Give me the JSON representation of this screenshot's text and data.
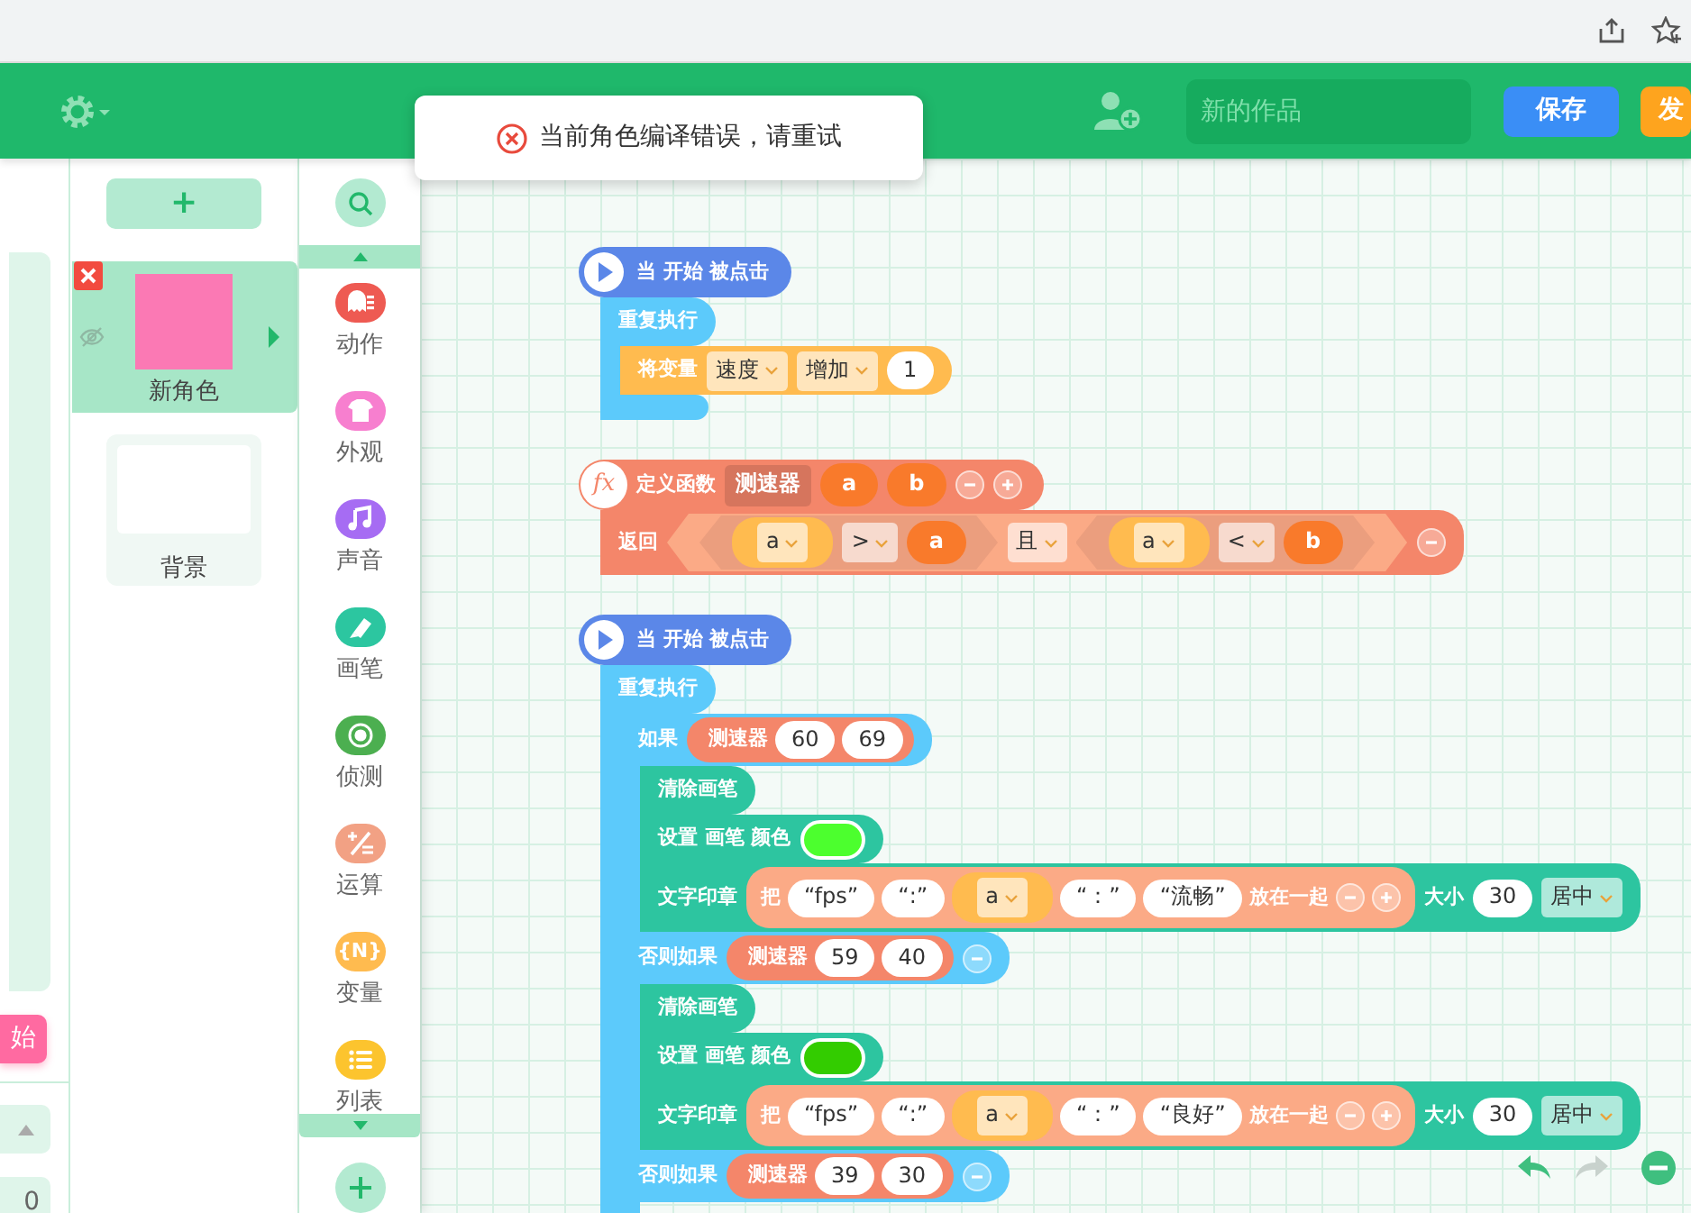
{
  "header": {
    "project_name": {
      "placeholder": "新的作品"
    },
    "buttons": [
      {
        "label": "保存",
        "kind": "save"
      },
      {
        "label": "发",
        "kind": "publish"
      }
    ]
  },
  "toast": {
    "text": "当前角色编译错误，请重试",
    "kind": "error"
  },
  "stage": {
    "start_button": "始",
    "counter": "0"
  },
  "sprites": {
    "add_label": "+",
    "items": [
      {
        "name": "新角色",
        "selected": true,
        "color": "#fb79b4"
      },
      {
        "name": "背景",
        "selected": false,
        "color": "#ffffff"
      }
    ]
  },
  "categories": [
    {
      "label": "动作",
      "color": "#ee5a52",
      "kind": "motion"
    },
    {
      "label": "外观",
      "color": "#f77fcf",
      "kind": "looks"
    },
    {
      "label": "声音",
      "color": "#a66cf3",
      "kind": "sound"
    },
    {
      "label": "画笔",
      "color": "#2cc6a0",
      "kind": "pen"
    },
    {
      "label": "侦测",
      "color": "#4caf50",
      "kind": "sensing"
    },
    {
      "label": "运算",
      "color": "#f2a184",
      "kind": "operators"
    },
    {
      "label": "变量",
      "color": "#ffbb4f",
      "kind": "variables",
      "glyph": "{N}"
    },
    {
      "label": "列表",
      "color": "#fcc42e",
      "kind": "lists"
    }
  ],
  "scripts": [
    {
      "blocks": [
        {
          "kind": "hat",
          "color": "#5b87e8",
          "parts": [
            {
              "kind": "text",
              "text": "当 开始 被点击"
            }
          ]
        },
        {
          "kind": "c",
          "color": "#5ccafb",
          "foot": true,
          "arms": [
            {
              "parts": [
                {
                  "kind": "text",
                  "text": "重复执行"
                }
              ],
              "children": [
                {
                  "kind": "stack",
                  "color": "#ffbb4f",
                  "parts": [
                    {
                      "kind": "text",
                      "text": "将变量"
                    },
                    {
                      "kind": "dropdown",
                      "text": "速度"
                    },
                    {
                      "kind": "dropdown",
                      "text": "增加"
                    },
                    {
                      "kind": "number",
                      "text": "1"
                    }
                  ]
                }
              ]
            }
          ]
        }
      ]
    },
    {
      "blocks": [
        {
          "kind": "define",
          "color": "#f4866a",
          "icon_text": "fx",
          "parts": [
            {
              "kind": "text",
              "text": "定义函数"
            },
            {
              "kind": "name",
              "text": "测速器"
            },
            {
              "kind": "arg",
              "text": "a"
            },
            {
              "kind": "arg",
              "text": "b"
            },
            {
              "kind": "minus"
            },
            {
              "kind": "plus"
            }
          ]
        },
        {
          "kind": "stack",
          "color": "#f4866a",
          "parts": [
            {
              "kind": "text",
              "text": "返回"
            },
            {
              "kind": "bool",
              "parts": [
                {
                  "kind": "bool",
                  "parts": [
                    {
                      "kind": "var",
                      "text": "a"
                    },
                    {
                      "kind": "dropdown",
                      "text": ">"
                    },
                    {
                      "kind": "arg",
                      "text": "a"
                    }
                  ]
                },
                {
                  "kind": "dropdown",
                  "text": "且"
                },
                {
                  "kind": "bool",
                  "parts": [
                    {
                      "kind": "var",
                      "text": "a"
                    },
                    {
                      "kind": "dropdown",
                      "text": "<"
                    },
                    {
                      "kind": "arg",
                      "text": "b"
                    }
                  ]
                }
              ]
            },
            {
              "kind": "minus"
            }
          ]
        }
      ]
    },
    {
      "blocks": [
        {
          "kind": "hat",
          "color": "#5b87e8",
          "parts": [
            {
              "kind": "text",
              "text": "当 开始 被点击"
            }
          ]
        },
        {
          "kind": "c",
          "color": "#5ccafb",
          "arms": [
            {
              "parts": [
                {
                  "kind": "text",
                  "text": "重复执行"
                }
              ],
              "children": [
                {
                  "kind": "c",
                  "color": "#5ccafb",
                  "arms": [
                    {
                      "parts": [
                        {
                          "kind": "text",
                          "text": "如果"
                        },
                        {
                          "kind": "call",
                          "text": "测速器",
                          "parts": [
                            {
                              "kind": "number",
                              "text": "60"
                            },
                            {
                              "kind": "number",
                              "text": "69"
                            }
                          ]
                        }
                      ],
                      "children": [
                        {
                          "kind": "stack",
                          "color": "#2dc5a0",
                          "parts": [
                            {
                              "kind": "text",
                              "text": "清除画笔"
                            }
                          ]
                        },
                        {
                          "kind": "stack",
                          "color": "#2dc5a0",
                          "parts": [
                            {
                              "kind": "text",
                              "text": "设置 画笔 颜色"
                            },
                            {
                              "kind": "color",
                              "color": "#4cff2e"
                            }
                          ]
                        },
                        {
                          "kind": "stack",
                          "color": "#2dc5a0",
                          "parts": [
                            {
                              "kind": "text",
                              "text": "文字印章"
                            },
                            {
                              "kind": "join",
                              "parts": [
                                {
                                  "kind": "text",
                                  "text": "把"
                                },
                                {
                                  "kind": "string",
                                  "text": "“fps”"
                                },
                                {
                                  "kind": "string",
                                  "text": "“:”"
                                },
                                {
                                  "kind": "var",
                                  "text": "a"
                                },
                                {
                                  "kind": "string",
                                  "text": "“：”"
                                },
                                {
                                  "kind": "string",
                                  "text": "“流畅”"
                                },
                                {
                                  "kind": "text",
                                  "text": "放在一起"
                                },
                                {
                                  "kind": "minus"
                                },
                                {
                                  "kind": "plus"
                                }
                              ]
                            },
                            {
                              "kind": "text",
                              "text": "大小"
                            },
                            {
                              "kind": "number",
                              "text": "30"
                            },
                            {
                              "kind": "dropdown",
                              "text": "居中"
                            }
                          ]
                        }
                      ]
                    },
                    {
                      "parts": [
                        {
                          "kind": "text",
                          "text": "否则如果"
                        },
                        {
                          "kind": "call",
                          "text": "测速器",
                          "parts": [
                            {
                              "kind": "number",
                              "text": "59"
                            },
                            {
                              "kind": "number",
                              "text": "40"
                            }
                          ]
                        },
                        {
                          "kind": "minus"
                        }
                      ],
                      "children": [
                        {
                          "kind": "stack",
                          "color": "#2dc5a0",
                          "parts": [
                            {
                              "kind": "text",
                              "text": "清除画笔"
                            }
                          ]
                        },
                        {
                          "kind": "stack",
                          "color": "#2dc5a0",
                          "parts": [
                            {
                              "kind": "text",
                              "text": "设置 画笔 颜色"
                            },
                            {
                              "kind": "color",
                              "color": "#33cc00"
                            }
                          ]
                        },
                        {
                          "kind": "stack",
                          "color": "#2dc5a0",
                          "parts": [
                            {
                              "kind": "text",
                              "text": "文字印章"
                            },
                            {
                              "kind": "join",
                              "parts": [
                                {
                                  "kind": "text",
                                  "text": "把"
                                },
                                {
                                  "kind": "string",
                                  "text": "“fps”"
                                },
                                {
                                  "kind": "string",
                                  "text": "“:”"
                                },
                                {
                                  "kind": "var",
                                  "text": "a"
                                },
                                {
                                  "kind": "string",
                                  "text": "“：”"
                                },
                                {
                                  "kind": "string",
                                  "text": "“良好”"
                                },
                                {
                                  "kind": "text",
                                  "text": "放在一起"
                                },
                                {
                                  "kind": "minus"
                                },
                                {
                                  "kind": "plus"
                                }
                              ]
                            },
                            {
                              "kind": "text",
                              "text": "大小"
                            },
                            {
                              "kind": "number",
                              "text": "30"
                            },
                            {
                              "kind": "dropdown",
                              "text": "居中"
                            }
                          ]
                        }
                      ]
                    },
                    {
                      "parts": [
                        {
                          "kind": "text",
                          "text": "否则如果"
                        },
                        {
                          "kind": "call",
                          "text": "测速器",
                          "parts": [
                            {
                              "kind": "number",
                              "text": "39"
                            },
                            {
                              "kind": "number",
                              "text": "30"
                            }
                          ]
                        },
                        {
                          "kind": "minus"
                        }
                      ]
                    }
                  ]
                }
              ]
            }
          ]
        }
      ]
    }
  ]
}
